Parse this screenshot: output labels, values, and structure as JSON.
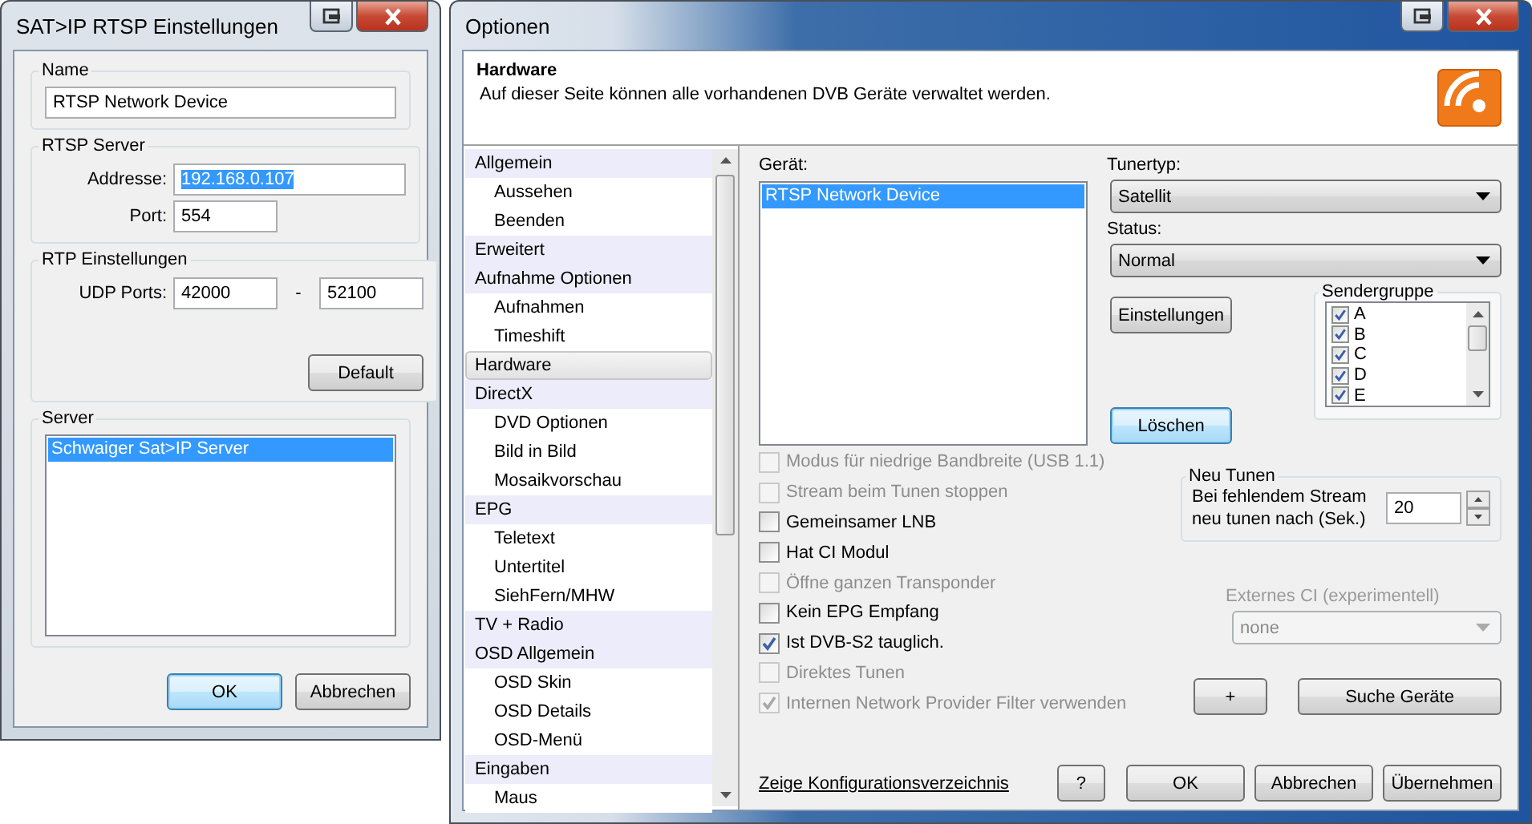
{
  "dialog": {
    "title": "SAT>IP RTSP Einstellungen",
    "name_group": {
      "label": "Name",
      "value": "RTSP Network Device"
    },
    "rtsp_server": {
      "label": "RTSP Server",
      "address_label": "Addresse:",
      "address": "192.168.0.107",
      "address_selected": true,
      "port_label": "Port:",
      "port": "554"
    },
    "rtp": {
      "label": "RTP Einstellungen",
      "udp_label": "UDP Ports:",
      "from": "42000",
      "separator": "-",
      "to": "52100",
      "default_button": "Default"
    },
    "server": {
      "label": "Server",
      "items": [
        {
          "label": "Schwaiger Sat>IP Server",
          "selected": true
        }
      ]
    },
    "buttons": [
      {
        "label": "OK",
        "default": true
      },
      {
        "label": "Abbrechen",
        "default": false
      }
    ]
  },
  "options": {
    "title": "Optionen",
    "header": {
      "title": "Hardware",
      "description": "Auf dieser Seite können alle vorhandenen DVB Geräte verwaltet werden."
    },
    "nav": [
      {
        "label": "Allgemein",
        "selected": false,
        "children": [
          {
            "label": "Aussehen",
            "selected": false
          },
          {
            "label": "Beenden",
            "selected": false
          }
        ]
      },
      {
        "label": "Erweitert",
        "selected": false
      },
      {
        "label": "Aufnahme Optionen",
        "selected": false,
        "children": [
          {
            "label": "Aufnahmen",
            "selected": false
          },
          {
            "label": "Timeshift",
            "selected": false
          }
        ]
      },
      {
        "label": "Hardware",
        "selected": true
      },
      {
        "label": "DirectX",
        "selected": false,
        "children": [
          {
            "label": "DVD Optionen",
            "selected": false
          },
          {
            "label": "Bild in Bild",
            "selected": false
          },
          {
            "label": "Mosaikvorschau",
            "selected": false
          }
        ]
      },
      {
        "label": "EPG",
        "selected": false,
        "children": [
          {
            "label": "Teletext",
            "selected": false
          },
          {
            "label": "Untertitel",
            "selected": false
          },
          {
            "label": "SiehFern/MHW",
            "selected": false
          }
        ]
      },
      {
        "label": "TV + Radio",
        "selected": false
      },
      {
        "label": "OSD Allgemein",
        "selected": false,
        "children": [
          {
            "label": "OSD Skin",
            "selected": false
          },
          {
            "label": "OSD Details",
            "selected": false
          },
          {
            "label": "OSD-Menü",
            "selected": false
          }
        ]
      },
      {
        "label": "Eingaben",
        "selected": false,
        "children": [
          {
            "label": "Maus",
            "selected": false
          }
        ]
      }
    ],
    "device_label": "Gerät:",
    "devices": [
      {
        "label": "RTSP Network Device",
        "selected": true
      }
    ],
    "tuner_type": {
      "label": "Tunertyp:",
      "value": "Satellit"
    },
    "status": {
      "label": "Status:",
      "value": "Normal"
    },
    "settings_button": {
      "label": "Einstellungen",
      "default": false
    },
    "delete_button": {
      "label": "Löschen",
      "default": true
    },
    "channel_group": {
      "label": "Sendergruppe",
      "items": [
        {
          "label": "A",
          "checked": true
        },
        {
          "label": "B",
          "checked": true
        },
        {
          "label": "C",
          "checked": true
        },
        {
          "label": "D",
          "checked": true
        },
        {
          "label": "E",
          "checked": true
        }
      ]
    },
    "flags": [
      {
        "label": "Modus für niedrige Bandbreite (USB 1.1)",
        "checked": false,
        "disabled": true
      },
      {
        "label": "Stream beim Tunen stoppen",
        "checked": false,
        "disabled": true
      },
      {
        "label": "Gemeinsamer LNB",
        "checked": false,
        "disabled": false
      },
      {
        "label": "Hat CI Modul",
        "checked": false,
        "disabled": false
      },
      {
        "label": "Öffne ganzen Transponder",
        "checked": false,
        "disabled": true
      },
      {
        "label": "Kein EPG Empfang",
        "checked": false,
        "disabled": false
      },
      {
        "label": "Ist DVB-S2 tauglich.",
        "checked": true,
        "disabled": false
      },
      {
        "label": "Direktes Tunen",
        "checked": false,
        "disabled": true
      },
      {
        "label": "Internen Network Provider Filter verwenden",
        "checked": true,
        "disabled": true
      }
    ],
    "retune": {
      "label": "Neu Tunen",
      "text": "Bei fehlendem Stream neu tunen nach (Sek.)",
      "value": "20"
    },
    "external_ci": {
      "label": "Externes CI (experimentell)",
      "value": "none",
      "disabled": true
    },
    "plus_button": "+",
    "search_button": "Suche Geräte",
    "config_link": "Zeige Konfigurationsverzeichnis",
    "help_button": "?",
    "buttons": [
      {
        "label": "OK",
        "default": false
      },
      {
        "label": "Abbrechen",
        "default": false
      },
      {
        "label": "Übernehmen",
        "default": false
      }
    ]
  }
}
